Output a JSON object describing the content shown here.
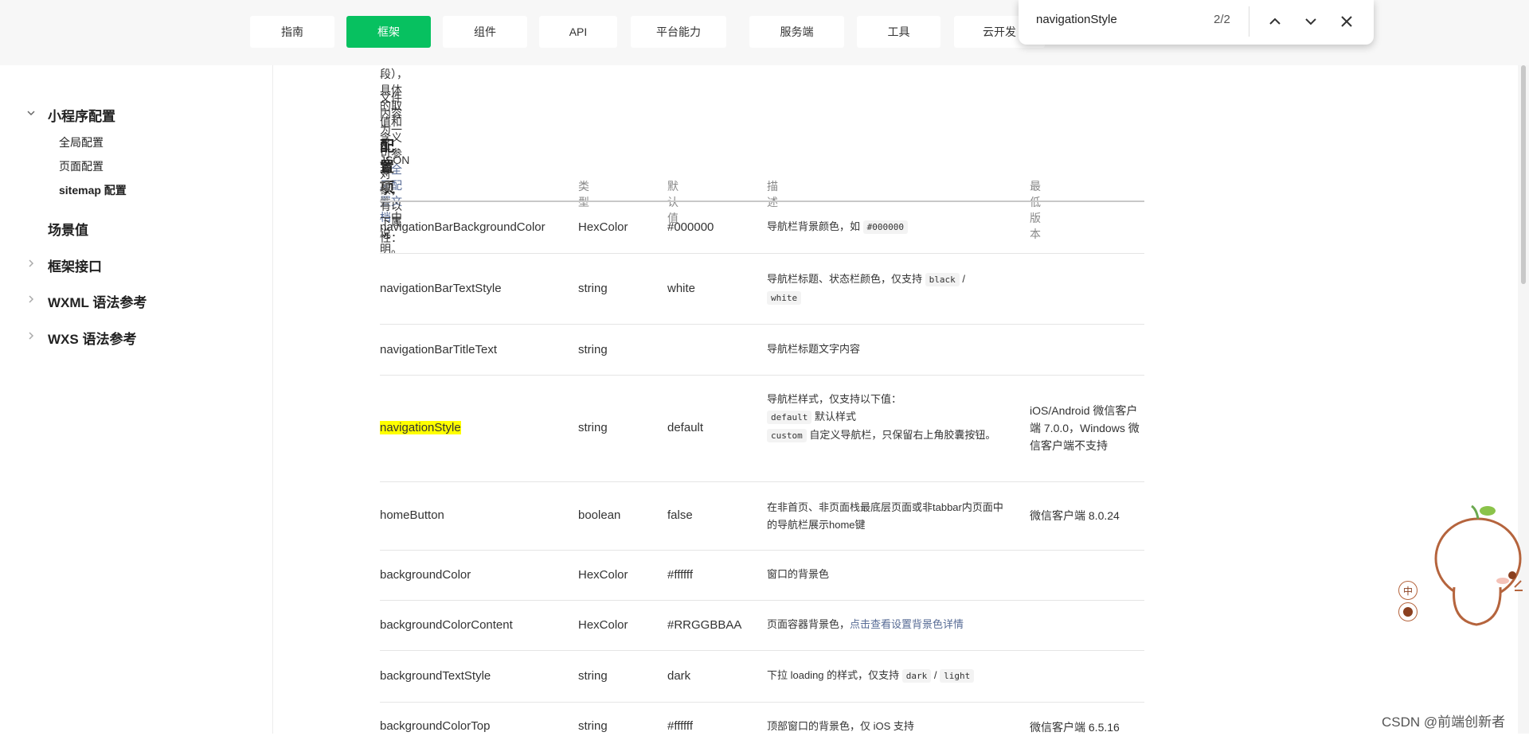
{
  "topnav": {
    "tabs": [
      {
        "label": "指南"
      },
      {
        "label": "框架"
      },
      {
        "label": "组件"
      },
      {
        "label": "API"
      },
      {
        "label": "平台能力"
      },
      {
        "label": "服务端"
      },
      {
        "label": "工具"
      },
      {
        "label": "云开发"
      }
    ],
    "active_tab": "框架",
    "accent_color": "#07c160"
  },
  "find_bar": {
    "query": "navigationStyle",
    "match_count": "2/2"
  },
  "sidebar": {
    "items": [
      {
        "label": "小程序配置",
        "expanded": true
      },
      {
        "label": "全局配置"
      },
      {
        "label": "页面配置"
      },
      {
        "label": "sitemap 配置"
      },
      {
        "label": "场景值"
      },
      {
        "label": "框架接口"
      },
      {
        "label": "WXML 语法参考"
      },
      {
        "label": "WXS 语法参考"
      }
    ]
  },
  "content": {
    "intro_line1_pre": "段），具体的取值和含义可参考",
    "intro_line1_link": "全局配置文档",
    "intro_line1_post": "中说明。",
    "intro_line2": "文件内容为一个 JSON 对象，有以下属性：",
    "section_title": "配置项",
    "table": {
      "headers": [
        "属性",
        "类型",
        "默认值",
        "描述",
        "最低版本"
      ],
      "rows": [
        {
          "name": "navigationBarBackgroundColor",
          "type": "HexColor",
          "default": "#000000",
          "desc_text": "导航栏背景颜色，如",
          "desc_code": "#000000",
          "version": ""
        },
        {
          "name": "navigationBarTextStyle",
          "type": "string",
          "default": "white",
          "desc_text": "导航栏标题、状态栏颜色，仅支持",
          "desc_code1": "black",
          "desc_sep": "/",
          "desc_code2": "white",
          "version": ""
        },
        {
          "name": "navigationBarTitleText",
          "type": "string",
          "default": "",
          "desc_text": "导航栏标题文字内容",
          "version": ""
        },
        {
          "name": "navigationStyle",
          "type": "string",
          "default": "default",
          "desc_line1": "导航栏样式，仅支持以下值：",
          "desc_code1": "default",
          "desc_code1_text": "默认样式",
          "desc_code2": "custom",
          "desc_code2_text": "自定义导航栏，只保留右上角胶囊按钮。",
          "version": "iOS/Android 微信客户端 7.0.0，Windows 微信客户端不支持"
        },
        {
          "name": "homeButton",
          "type": "boolean",
          "default": "false",
          "desc_text": "在非首页、非页面栈最底层页面或非tabbar内页面中的导航栏展示home键",
          "version": "微信客户端 8.0.24"
        },
        {
          "name": "backgroundColor",
          "type": "HexColor",
          "default": "#ffffff",
          "desc_text": "窗口的背景色",
          "version": ""
        },
        {
          "name": "backgroundColorContent",
          "type": "HexColor",
          "default": "#RRGGBBAA",
          "desc_text": "页面容器背景色，",
          "desc_link": "点击查看设置背景色详情",
          "version": ""
        },
        {
          "name": "backgroundTextStyle",
          "type": "string",
          "default": "dark",
          "desc_text": "下拉 loading 的样式，仅支持",
          "desc_code1": "dark",
          "desc_sep": "/",
          "desc_code2": "light",
          "version": ""
        },
        {
          "name": "backgroundColorTop",
          "type": "string",
          "default": "#ffffff",
          "desc_text": "顶部窗口的背景色，仅 iOS 支持",
          "version": "微信客户端 6.5.16"
        }
      ]
    }
  },
  "mascot_badges": [
    "中"
  ],
  "watermark": "CSDN @前端创新者"
}
